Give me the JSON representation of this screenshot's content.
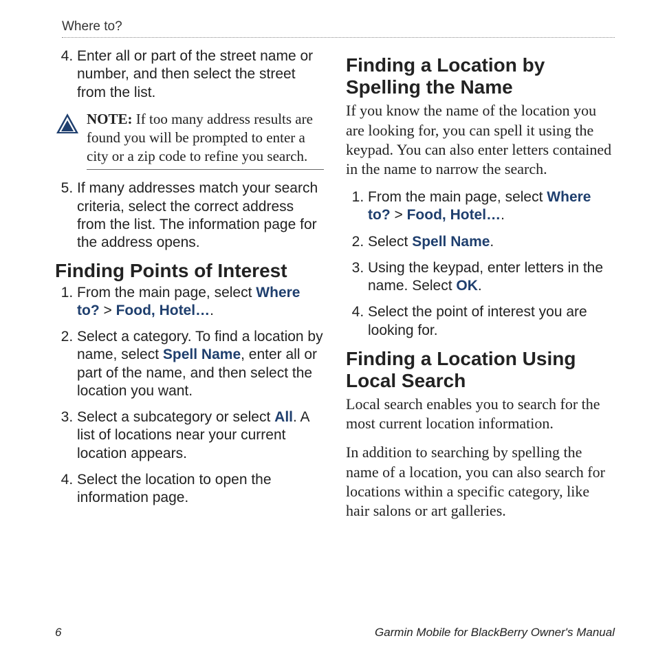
{
  "header": {
    "section": "Where to?"
  },
  "left": {
    "list_a_start": 4,
    "list_a": [
      "Enter all or part of the street name or number, and then select the street from the list."
    ],
    "note": {
      "label": "NOTE:",
      "text": " If too many address results are found you will be prompted to enter a city or a zip code to refine you search."
    },
    "list_b_start": 5,
    "list_b": [
      "If many addresses match your search criteria, select the correct address from the list. The information page for the address opens."
    ],
    "poi_title": "Finding Points of Interest",
    "poi_steps": [
      {
        "pre": "From the main page, select ",
        "b1": "Where to?",
        "mid": " > ",
        "b2": "Food, Hotel…",
        "post": "."
      },
      {
        "pre": "Select a category. To find a location by name, select ",
        "b1": "Spell Name",
        "post": ", enter all or part of the name, and then select the location you want."
      },
      {
        "pre": "Select a subcategory or select ",
        "b1": "All",
        "post": ". A list of locations near your current location appears."
      },
      {
        "pre": "Select the location to open the information page."
      }
    ]
  },
  "right": {
    "spell_title": "Finding a Location by Spelling the Name",
    "spell_body": "If you know the name of the location you are looking for, you can spell it using the keypad. You can also enter letters contained in the name to narrow the search.",
    "spell_steps": [
      {
        "pre": "From the main page, select ",
        "b1": "Where to?",
        "mid": " > ",
        "b2": "Food, Hotel…",
        "post": "."
      },
      {
        "pre": "Select ",
        "b1": "Spell Name",
        "post": "."
      },
      {
        "pre": "Using the keypad, enter letters in the name. Select ",
        "b1": "OK",
        "post": "."
      },
      {
        "pre": "Select the point of interest you are looking for."
      }
    ],
    "local_title": "Finding a Location Using Local Search",
    "local_body1": "Local search enables you to search for the most current location information.",
    "local_body2": "In addition to searching by spelling the name of a location, you can also search for locations within a specific category, like hair salons or art galleries."
  },
  "footer": {
    "page": "6",
    "doc": "Garmin Mobile for BlackBerry Owner's Manual"
  }
}
